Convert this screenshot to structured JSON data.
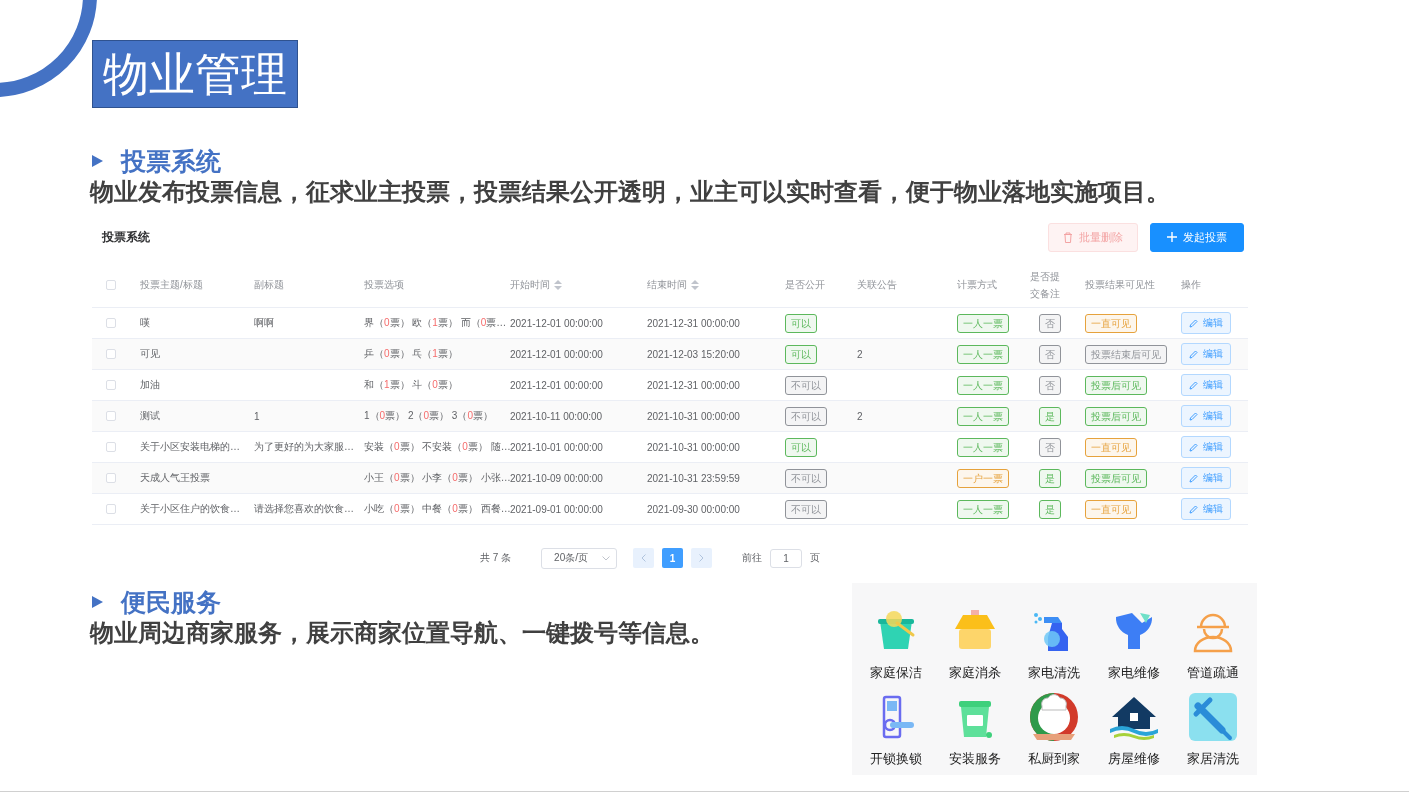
{
  "slide": {
    "title": "物业管理"
  },
  "voting_section": {
    "heading": "投票系统",
    "description": "物业发布投票信息，征求业主投票，投票结果公开透明，业主可以实时查看，便于物业落地实施项目。"
  },
  "vote_panel": {
    "title": "投票系统",
    "buttons": [
      {
        "kind": "delete",
        "label": "批量删除",
        "disabled": true
      },
      {
        "kind": "create",
        "label": "发起投票",
        "disabled": false
      }
    ],
    "select_all": {
      "checked": false
    },
    "columns": [
      {
        "label": "投票主题/标题",
        "sortable": false
      },
      {
        "label": "副标题",
        "sortable": false
      },
      {
        "label": "投票选项",
        "sortable": false
      },
      {
        "label": "开始时间",
        "sortable": true
      },
      {
        "label": "结束时间",
        "sortable": true
      },
      {
        "label": "是否公开",
        "sortable": false
      },
      {
        "label": "关联公告",
        "sortable": false
      },
      {
        "label": "计票方式",
        "sortable": false
      },
      {
        "label": "是否提交备注",
        "sortable": false
      },
      {
        "label": "投票结果可见性",
        "sortable": false
      },
      {
        "label": "操作",
        "sortable": false
      }
    ],
    "rows": [
      {
        "selected": false,
        "title": "嘆",
        "subtitle": "啊啊",
        "options": [
          {
            "pre": "界（",
            "votes": "0",
            "post": "票）"
          },
          {
            "pre": "欧（",
            "votes": "1",
            "post": "票）"
          },
          {
            "pre": "而（",
            "votes": "0",
            "post": "票…"
          }
        ],
        "start": "2021-12-01 00:00:00",
        "end": "2021-12-31 00:00:00",
        "public": {
          "text": "可以",
          "color": "#5cb85c"
        },
        "notice": "",
        "counting": {
          "text": "一人一票",
          "color": "#5cb85c"
        },
        "remark": {
          "text": "否",
          "color": "#909399"
        },
        "visibility": {
          "text": "一直可见",
          "color": "#e6a23c"
        },
        "action": "编辑"
      },
      {
        "selected": false,
        "title": "可见",
        "subtitle": "",
        "options": [
          {
            "pre": "乒（",
            "votes": "0",
            "post": "票）"
          },
          {
            "pre": "乓（",
            "votes": "1",
            "post": "票）"
          }
        ],
        "start": "2021-12-01 00:00:00",
        "end": "2021-12-03 15:20:00",
        "public": {
          "text": "可以",
          "color": "#5cb85c"
        },
        "notice": "2",
        "counting": {
          "text": "一人一票",
          "color": "#5cb85c"
        },
        "remark": {
          "text": "否",
          "color": "#909399"
        },
        "visibility": {
          "text": "投票结束后可见",
          "color": "#909399"
        },
        "action": "编辑"
      },
      {
        "selected": false,
        "title": "加油",
        "subtitle": "",
        "options": [
          {
            "pre": "和（",
            "votes": "1",
            "post": "票）"
          },
          {
            "pre": "斗（",
            "votes": "0",
            "post": "票）"
          }
        ],
        "start": "2021-12-01 00:00:00",
        "end": "2021-12-31 00:00:00",
        "public": {
          "text": "不可以",
          "color": "#909399"
        },
        "notice": "",
        "counting": {
          "text": "一人一票",
          "color": "#5cb85c"
        },
        "remark": {
          "text": "否",
          "color": "#909399"
        },
        "visibility": {
          "text": "投票后可见",
          "color": "#5cb85c"
        },
        "action": "编辑"
      },
      {
        "selected": false,
        "title": "测试",
        "subtitle": "1",
        "options": [
          {
            "pre": "1（",
            "votes": "0",
            "post": "票）"
          },
          {
            "pre": "2（",
            "votes": "0",
            "post": "票）"
          },
          {
            "pre": "3（",
            "votes": "0",
            "post": "票）"
          }
        ],
        "start": "2021-10-11 00:00:00",
        "end": "2021-10-31 00:00:00",
        "public": {
          "text": "不可以",
          "color": "#909399"
        },
        "notice": "2",
        "counting": {
          "text": "一人一票",
          "color": "#5cb85c"
        },
        "remark": {
          "text": "是",
          "color": "#5cb85c"
        },
        "visibility": {
          "text": "投票后可见",
          "color": "#5cb85c"
        },
        "action": "编辑"
      },
      {
        "selected": false,
        "title": "关于小区安装电梯的…",
        "subtitle": "为了更好的为大家服…",
        "options": [
          {
            "pre": "安装（",
            "votes": "0",
            "post": "票）"
          },
          {
            "pre": "不安装（",
            "votes": "0",
            "post": "票）"
          },
          {
            "pre": "随…"
          }
        ],
        "start": "2021-10-01 00:00:00",
        "end": "2021-10-31 00:00:00",
        "public": {
          "text": "可以",
          "color": "#5cb85c"
        },
        "notice": "",
        "counting": {
          "text": "一人一票",
          "color": "#5cb85c"
        },
        "remark": {
          "text": "否",
          "color": "#909399"
        },
        "visibility": {
          "text": "一直可见",
          "color": "#e6a23c"
        },
        "action": "编辑"
      },
      {
        "selected": false,
        "title": "天成人气王投票",
        "subtitle": "",
        "options": [
          {
            "pre": "小王（",
            "votes": "0",
            "post": "票）"
          },
          {
            "pre": "小李（",
            "votes": "0",
            "post": "票）"
          },
          {
            "pre": "小张…"
          }
        ],
        "start": "2021-10-09 00:00:00",
        "end": "2021-10-31 23:59:59",
        "public": {
          "text": "不可以",
          "color": "#909399"
        },
        "notice": "",
        "counting": {
          "text": "一户一票",
          "color": "#e6a23c"
        },
        "remark": {
          "text": "是",
          "color": "#5cb85c"
        },
        "visibility": {
          "text": "投票后可见",
          "color": "#5cb85c"
        },
        "action": "编辑"
      },
      {
        "selected": false,
        "title": "关于小区住户的饮食…",
        "subtitle": "请选择您喜欢的饮食…",
        "options": [
          {
            "pre": "小吃（",
            "votes": "0",
            "post": "票）"
          },
          {
            "pre": "中餐（",
            "votes": "0",
            "post": "票）"
          },
          {
            "pre": "西餐…"
          }
        ],
        "start": "2021-09-01 00:00:00",
        "end": "2021-09-30 00:00:00",
        "public": {
          "text": "不可以",
          "color": "#909399"
        },
        "notice": "",
        "counting": {
          "text": "一人一票",
          "color": "#5cb85c"
        },
        "remark": {
          "text": "是",
          "color": "#5cb85c"
        },
        "visibility": {
          "text": "一直可见",
          "color": "#e6a23c"
        },
        "action": "编辑"
      }
    ],
    "pagination": {
      "total": "共 7 条",
      "page_size": "20条/页",
      "pages": [
        {
          "label": "1",
          "selected": true
        }
      ],
      "jump_label": "前往",
      "jump_value": "1",
      "jump_suffix": "页"
    }
  },
  "services_section": {
    "heading": "便民服务",
    "description": "物业周边商家服务，展示商家位置导航、一键拨号等信息。",
    "services": [
      {
        "kind": "cleaning",
        "label": "家庭保洁"
      },
      {
        "kind": "disinfect",
        "label": "家庭消杀"
      },
      {
        "kind": "appliance-clean",
        "label": "家电清洗"
      },
      {
        "kind": "appliance-repair",
        "label": "家电维修"
      },
      {
        "kind": "pipe",
        "label": "管道疏通"
      },
      {
        "kind": "lock",
        "label": "开锁换锁"
      },
      {
        "kind": "install",
        "label": "安装服务"
      },
      {
        "kind": "chef",
        "label": "私厨到家"
      },
      {
        "kind": "house",
        "label": "房屋维修"
      },
      {
        "kind": "home-clean",
        "label": "家居清洗"
      }
    ]
  }
}
